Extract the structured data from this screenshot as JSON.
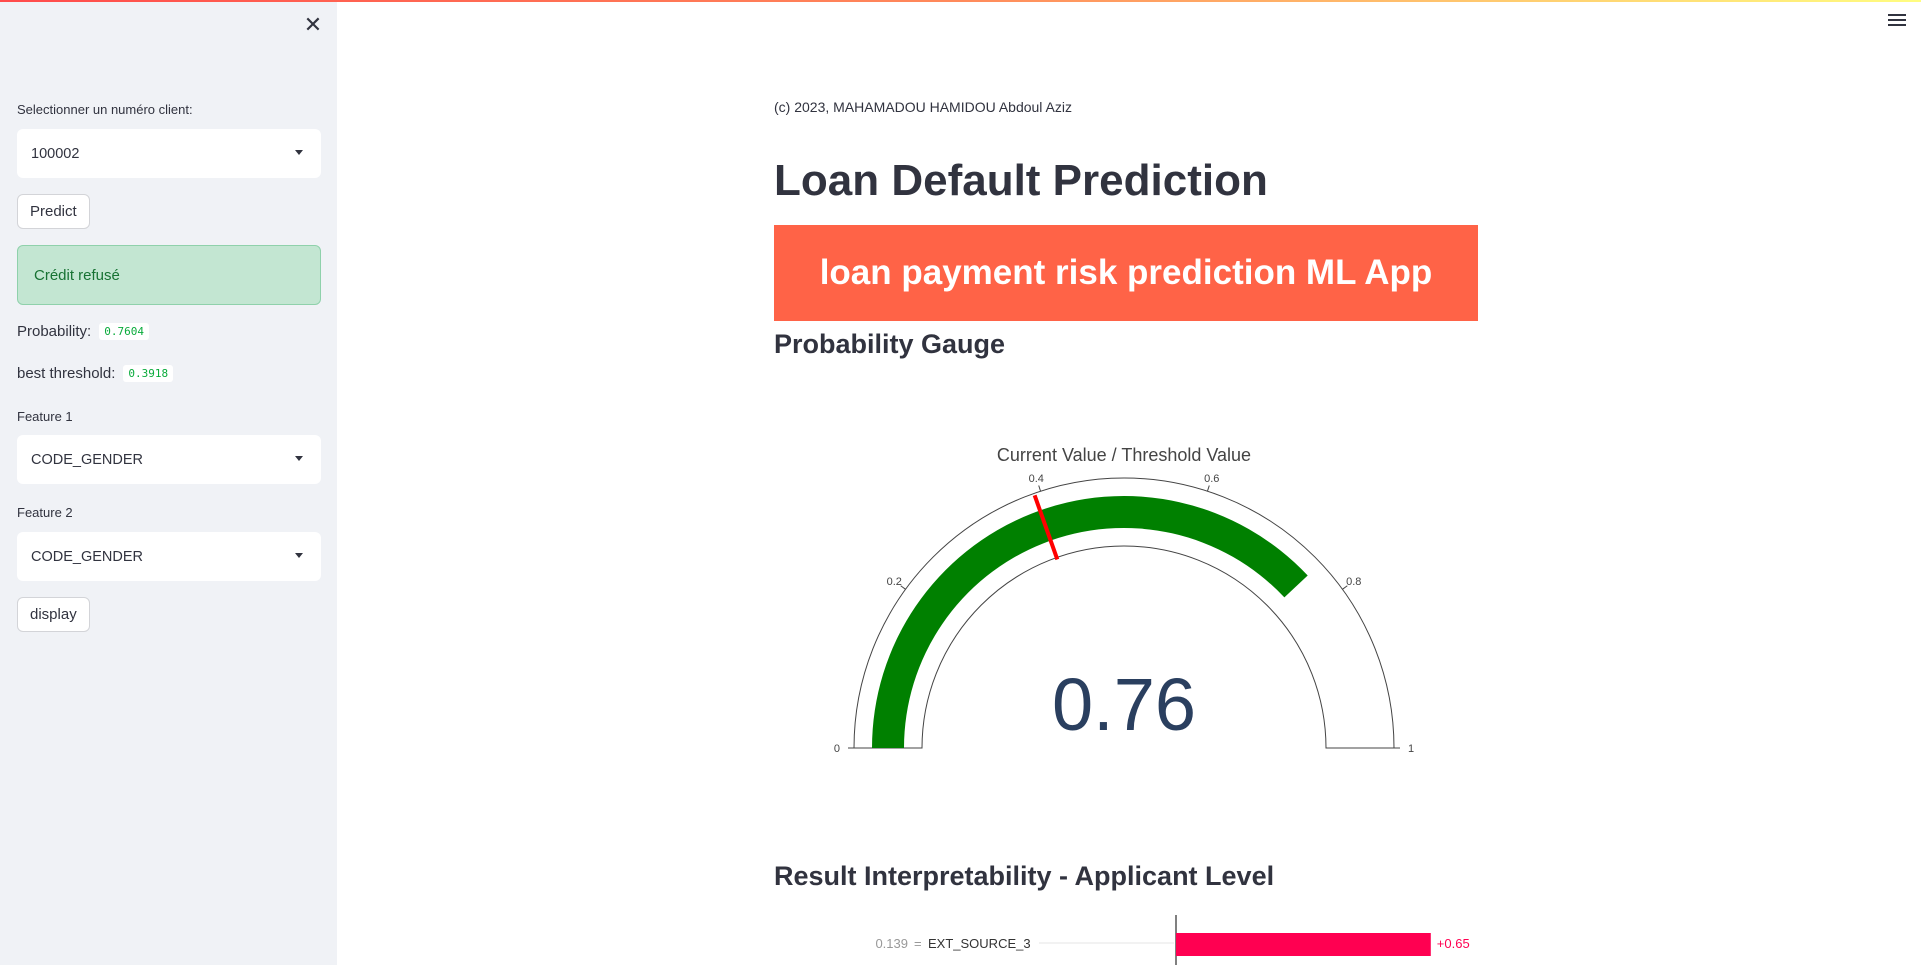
{
  "sidebar": {
    "client_label": "Selectionner un numéro client:",
    "client_value": "100002",
    "predict_label": "Predict",
    "result_text": "Crédit refusé",
    "probability_label": "Probability:",
    "probability_value": "0.7604",
    "threshold_label": "best threshold:",
    "threshold_value": "0.3918",
    "feature1_label": "Feature 1",
    "feature1_value": "CODE_GENDER",
    "feature2_label": "Feature 2",
    "feature2_value": "CODE_GENDER",
    "display_label": "display"
  },
  "main": {
    "copyright": "(c) 2023, MAHAMADOU HAMIDOU Abdoul Aziz",
    "title": "Loan Default Prediction",
    "banner": "loan payment risk prediction ML App",
    "gauge_heading": "Probability Gauge",
    "interpretability_heading": "Result Interpretability - Applicant Level"
  },
  "chart_data": [
    {
      "type": "gauge",
      "title": "Current Value / Threshold Value",
      "value": 0.76,
      "value_label": "0.76",
      "threshold": 0.3918,
      "range": [
        0,
        1
      ],
      "ticks": [
        0,
        0.2,
        0.4,
        0.6,
        0.8,
        1
      ],
      "tick_labels": [
        "0",
        "0.2",
        "0.4",
        "0.6",
        "0.8",
        "1"
      ],
      "bar_color": "#008000",
      "threshold_color": "#ff0000"
    },
    {
      "type": "bar",
      "feature_value": "0.139",
      "feature_name": "EXT_SOURCE_3",
      "value": 0.65,
      "value_label": "+0.65",
      "color": "#ff0051"
    }
  ],
  "colors": {
    "banner_bg": "#ff6347",
    "sidebar_bg": "#f0f2f6",
    "success_bg": "#c3e6d2",
    "success_text": "#177233"
  }
}
